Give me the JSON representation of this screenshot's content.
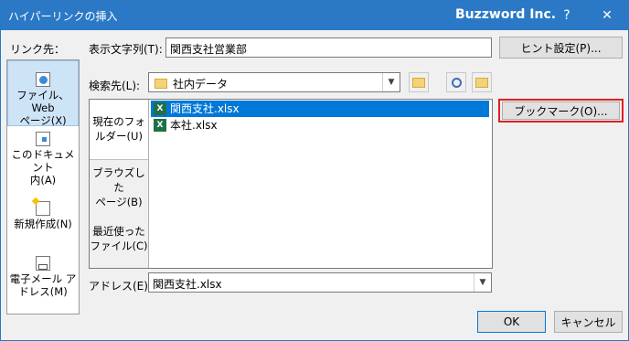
{
  "titlebar": {
    "title": "ハイパーリンクの挿入",
    "brand": "Buzzword Inc.",
    "help": "?",
    "close": "✕"
  },
  "link_to_label": "リンク先：",
  "sidebar": {
    "items": [
      {
        "line1": "ファイル、Web",
        "line2": "ページ(X)",
        "selected": true
      },
      {
        "line1": "このドキュメント",
        "line2": "内(A)",
        "selected": false
      },
      {
        "line1": "新規作成(N)",
        "line2": "",
        "selected": false
      },
      {
        "line1": "電子メール ア",
        "line2": "ドレス(M)",
        "selected": false
      }
    ]
  },
  "display_text": {
    "label": "表示文字列(T):",
    "value": "関西支社営業部"
  },
  "screentip_button": "ヒント設定(P)...",
  "look_in": {
    "label": "検索先(L):",
    "value": "社内データ"
  },
  "bookmark_button": "ブックマーク(O)...",
  "nav_tabs": [
    {
      "line1": "現在のフォ",
      "line2": "ルダー(U)"
    },
    {
      "line1": "ブラウズした",
      "line2": "ページ(B)"
    },
    {
      "line1": "最近使った",
      "line2": "ファイル(C)"
    }
  ],
  "files": [
    {
      "name": "関西支社.xlsx",
      "selected": true,
      "icon": "excel-icon"
    },
    {
      "name": "本社.xlsx",
      "selected": false,
      "icon": "excel-icon"
    }
  ],
  "address": {
    "label": "アドレス(E):",
    "value": "関西支社.xlsx"
  },
  "ok_button": "OK",
  "cancel_button": "キャンセル",
  "colors": {
    "titlebar": "#2b79c6",
    "selection": "#0078d7",
    "highlight_box": "#e02020",
    "excel": "#1e7145"
  }
}
